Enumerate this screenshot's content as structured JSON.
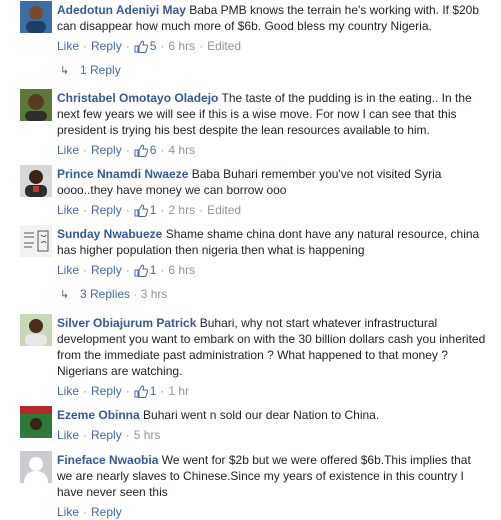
{
  "comments": [
    {
      "author": "Adedotun Adeniyi May",
      "text": "Baba PMB knows the terrain he's working with. If $20b can disappear how much more of $6b. Good bless my country Nigeria.",
      "like": "Like",
      "reply": "Reply",
      "likes": "5",
      "time": "6 hrs",
      "edited": "Edited",
      "avatar_color": "#3a6ea5"
    },
    {
      "author": "Christabel Omotayo Oladejo",
      "text": "The taste of the pudding is in the eating.. In the next few years we will see if this is a wise move. For now I can see that this president is trying his best despite the lean resources available to him.",
      "like": "Like",
      "reply": "Reply",
      "likes": "6",
      "time": "4 hrs",
      "avatar_color": "#5a7a3a"
    },
    {
      "author": "Prince Nnamdi Nwaeze",
      "text": "Baba Buhari remember you've not visited Syria oooo..they have money we can borrow ooo",
      "like": "Like",
      "reply": "Reply",
      "likes": "1",
      "time": "2 hrs",
      "edited": "Edited",
      "avatar_color": "#2c2c2c"
    },
    {
      "author": "Sunday Nwabueze",
      "text": "Shame shame china dont have any natural resource, china has higher population then nigeria then what is happening",
      "like": "Like",
      "reply": "Reply",
      "likes": "1",
      "time": "6 hrs",
      "avatar_color": "#e8e8e8"
    },
    {
      "author": "Silver Obiajurum Patrick",
      "text": "Buhari, why not start whatever infrastructural development you want to embark on with the 30 billion dollars cash you inherited from the immediate past administration ? What happened to that money ? Nigerians are watching.",
      "like": "Like",
      "reply": "Reply",
      "likes": "1",
      "time": "1 hr",
      "avatar_color": "#4a7a3a"
    },
    {
      "author": "Ezeme Obinna",
      "text": "Buhari went n sold our dear Nation to China.",
      "like": "Like",
      "reply": "Reply",
      "time": "5 hrs",
      "avatar_color": "#b22a2a"
    },
    {
      "author": "Fineface Nwaobia",
      "text": "We went for $2b but we were offered $6b.This implies that we are nearly slaves to Chinese.Since my years of existence in this country I have never seen this",
      "like": "Like",
      "reply": "Reply",
      "avatar_color": "#c9ccd1"
    }
  ],
  "reply_links": [
    {
      "label": "1 Reply",
      "time": ""
    },
    {
      "label": "3 Replies",
      "time": "3 hrs"
    }
  ],
  "colors": {
    "link": "#365899",
    "action": "#4267b2",
    "meta": "#90949c",
    "text": "#1d2129"
  }
}
